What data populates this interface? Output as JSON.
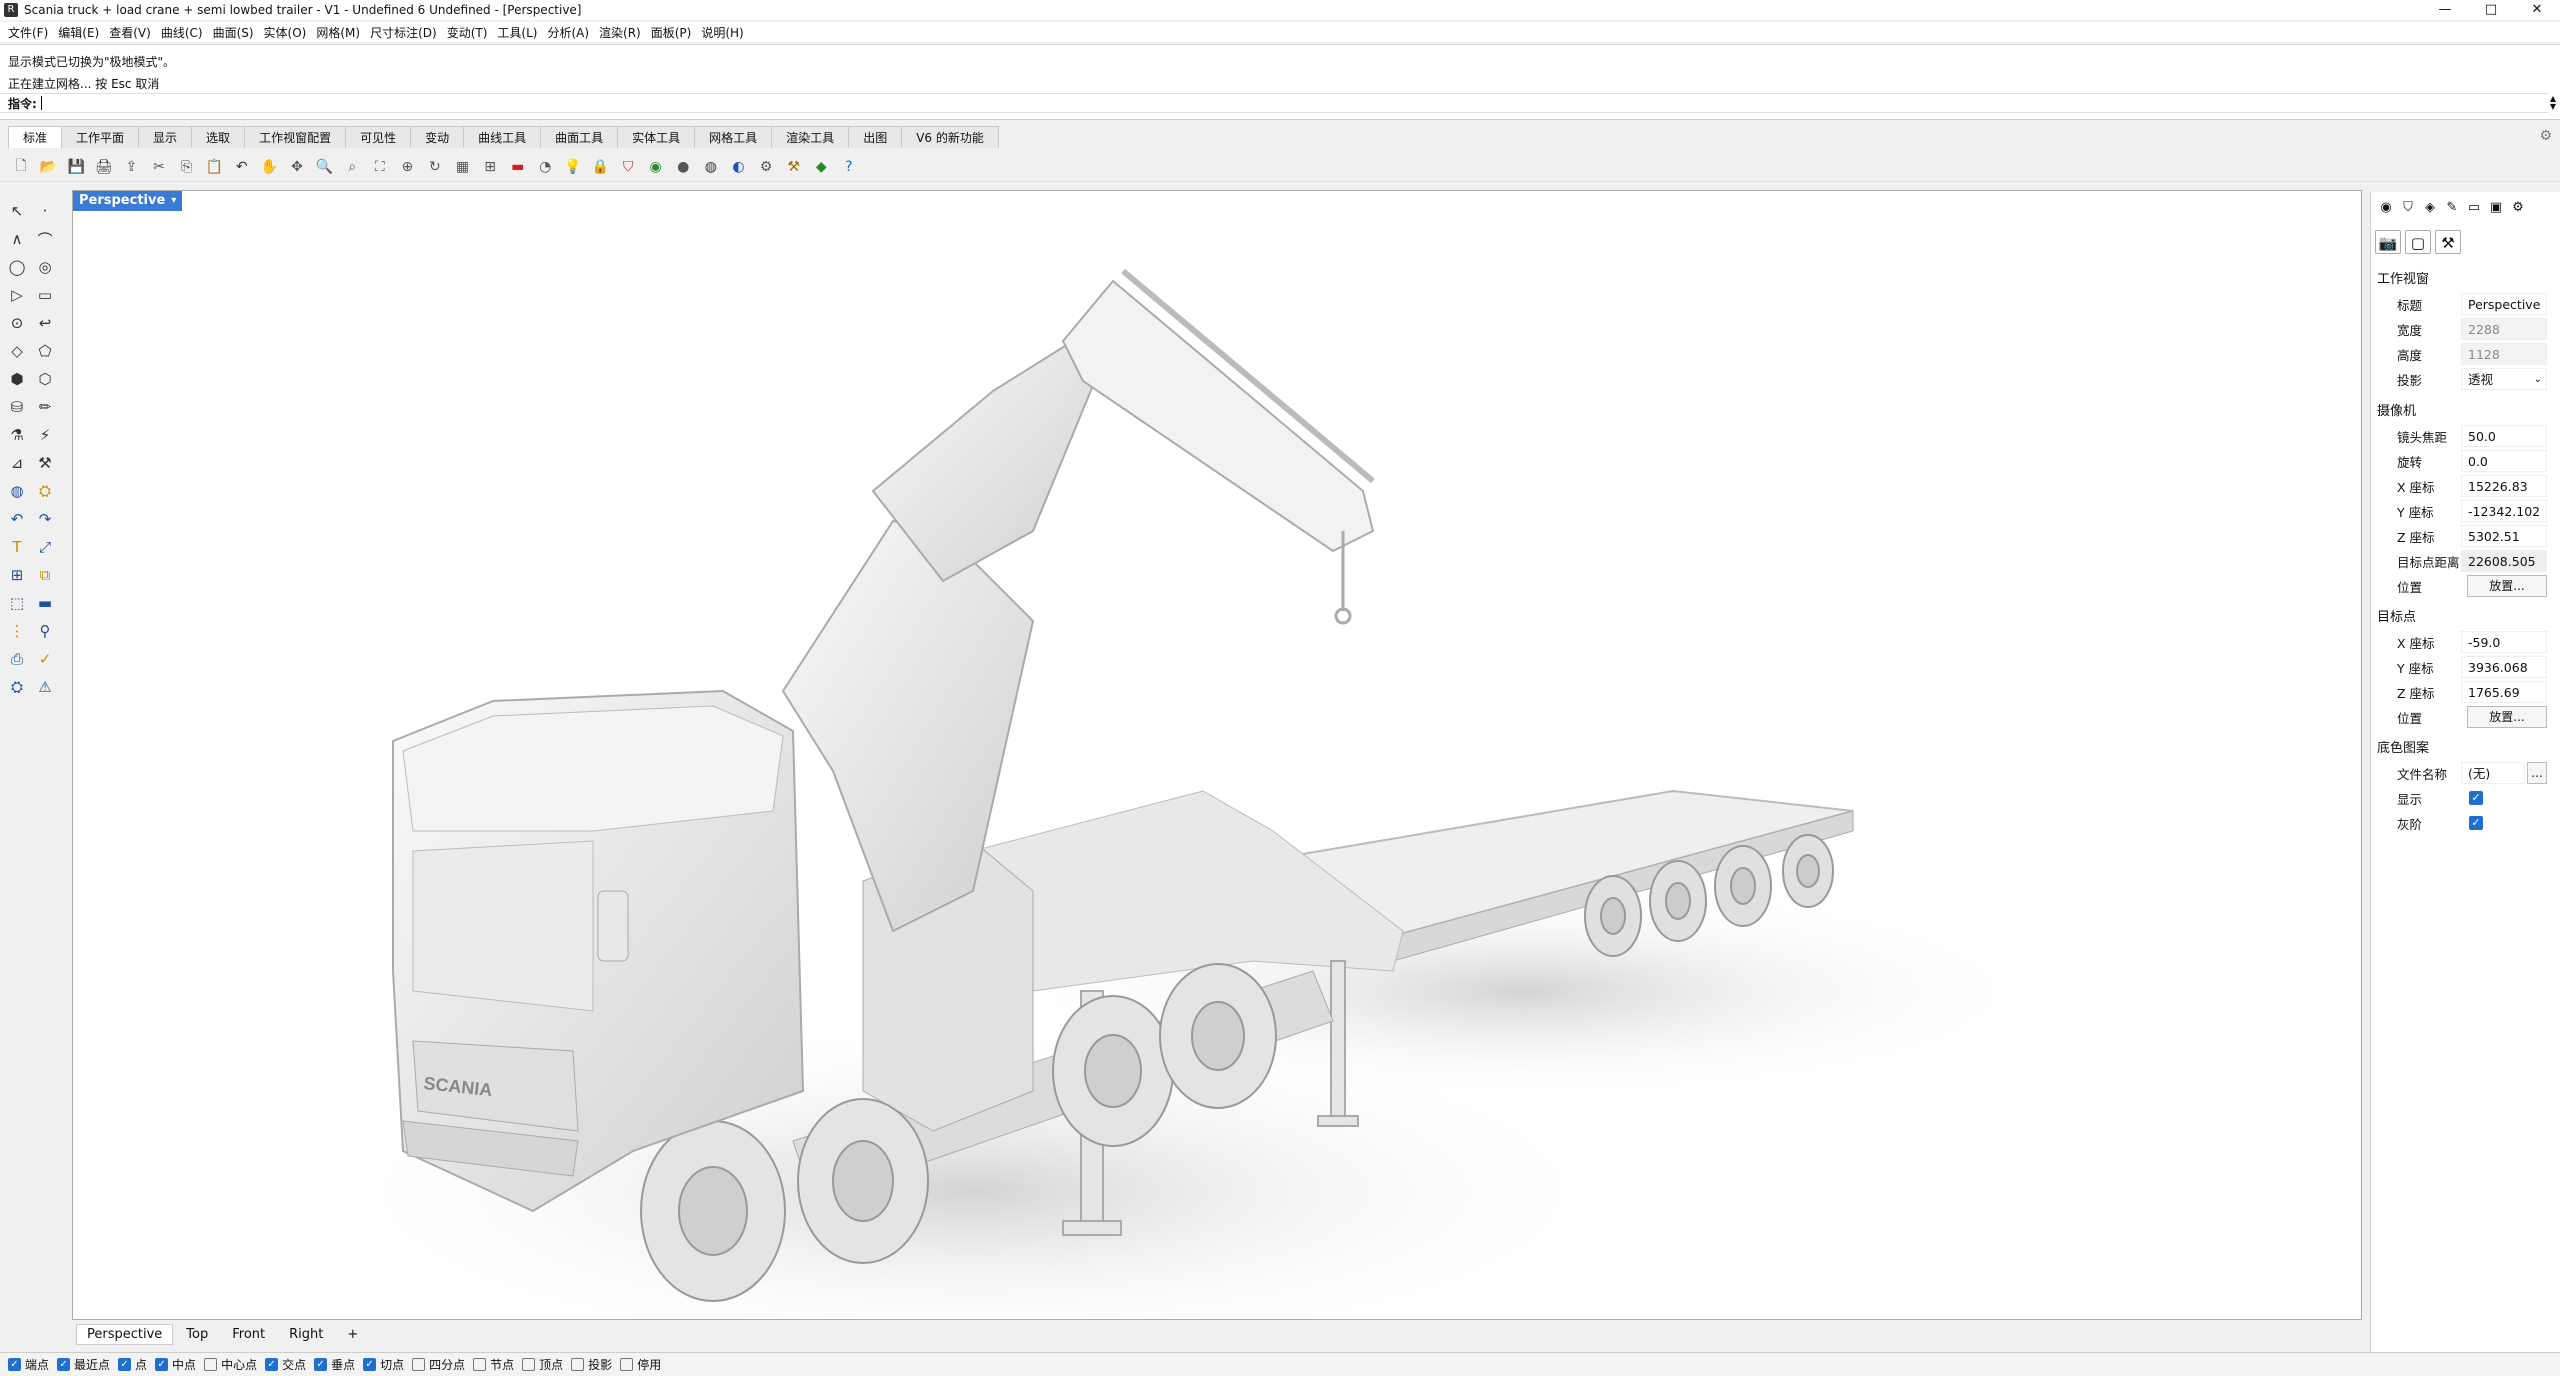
{
  "window": {
    "title": "Scania truck + load crane + semi lowbed trailer - V1 - Undefined 6 Undefined - [Perspective]",
    "controls": [
      "—",
      "□",
      "✕"
    ]
  },
  "menu": [
    "文件(F)",
    "编辑(E)",
    "查看(V)",
    "曲线(C)",
    "曲面(S)",
    "实体(O)",
    "网格(M)",
    "尺寸标注(D)",
    "变动(T)",
    "工具(L)",
    "分析(A)",
    "渲染(R)",
    "面板(P)",
    "说明(H)"
  ],
  "command": {
    "history": [
      "显示模式已切换为\"极地模式\"。",
      "正在建立网格... 按 Esc 取消"
    ],
    "prompt": "指令:"
  },
  "tabs": [
    "标准",
    "工作平面",
    "显示",
    "选取",
    "工作视窗配置",
    "可见性",
    "变动",
    "曲线工具",
    "曲面工具",
    "实体工具",
    "网格工具",
    "渲染工具",
    "出图",
    "V6 的新功能"
  ],
  "toolbar_icons": [
    "new-icon",
    "open-icon",
    "save-icon",
    "print-icon",
    "import-icon",
    "cut-icon",
    "copy-icon",
    "paste-icon",
    "undo-icon",
    "pan-icon",
    "move-view-icon",
    "zoom-icon",
    "zoom-window-icon",
    "zoom-extents-icon",
    "zoom-selected-icon",
    "rotate-view-icon",
    "four-views-icon",
    "cplane-icon",
    "ortho-icon",
    "layer-icon",
    "light-icon",
    "lock-icon",
    "properties-icon",
    "color-icon",
    "render-icon",
    "material-icon",
    "environment-icon",
    "options-icon",
    "gumball-icon",
    "grasshopper-icon",
    "help-icon"
  ],
  "toolbar_glyphs": [
    "🗋",
    "📂",
    "💾",
    "🖨",
    "⇪",
    "✂",
    "⎘",
    "📋",
    "↶",
    "✋",
    "✥",
    "🔍",
    "⌕",
    "⛶",
    "⊕",
    "↻",
    "▦",
    "⊞",
    "▬",
    "◔",
    "💡",
    "🔒",
    "⛉",
    "◉",
    "●",
    "◍",
    "◐",
    "⚙",
    "⚒",
    "◆",
    "?"
  ],
  "viewport": {
    "label": "Perspective",
    "dropdown": "▾",
    "tabs": [
      "Perspective",
      "Top",
      "Front",
      "Right"
    ],
    "add_tab": "+",
    "brand": "SCANIA"
  },
  "panel": {
    "section_view": "工作视窗",
    "title_label": "标题",
    "title_value": "Perspective",
    "width_label": "宽度",
    "width_value": "2288",
    "height_label": "高度",
    "height_value": "1128",
    "projection_label": "投影",
    "projection_value": "透视",
    "section_camera": "摄像机",
    "focal_label": "镜头焦距",
    "focal_value": "50.0",
    "rotation_label": "旋转",
    "rotation_value": "0.0",
    "cam_x_label": "X 座标",
    "cam_x_value": "15226.83",
    "cam_y_label": "Y 座标",
    "cam_y_value": "-12342.102",
    "cam_z_label": "Z 座标",
    "cam_z_value": "5302.51",
    "target_dist_label": "目标点距离",
    "target_dist_value": "22608.505",
    "position_label": "位置",
    "place_button": "放置...",
    "section_target": "目标点",
    "tgt_x_label": "X 座标",
    "tgt_x_value": "-59.0",
    "tgt_y_label": "Y 座标",
    "tgt_y_value": "3936.068",
    "tgt_z_label": "Z 座标",
    "tgt_z_value": "1765.69",
    "tgt_position_label": "位置",
    "tgt_place_button": "放置...",
    "section_wallpaper": "底色图案",
    "filename_label": "文件名称",
    "filename_value": "(无)",
    "browse_button": "...",
    "show_label": "显示",
    "gray_label": "灰阶"
  },
  "osnaps": [
    {
      "label": "端点",
      "on": true
    },
    {
      "label": "最近点",
      "on": true
    },
    {
      "label": "点",
      "on": true
    },
    {
      "label": "中点",
      "on": true
    },
    {
      "label": "中心点",
      "on": false
    },
    {
      "label": "交点",
      "on": true
    },
    {
      "label": "垂点",
      "on": true
    },
    {
      "label": "切点",
      "on": true
    },
    {
      "label": "四分点",
      "on": false
    },
    {
      "label": "节点",
      "on": false
    },
    {
      "label": "顶点",
      "on": false
    },
    {
      "label": "投影",
      "on": false
    },
    {
      "label": "停用",
      "on": false
    }
  ]
}
